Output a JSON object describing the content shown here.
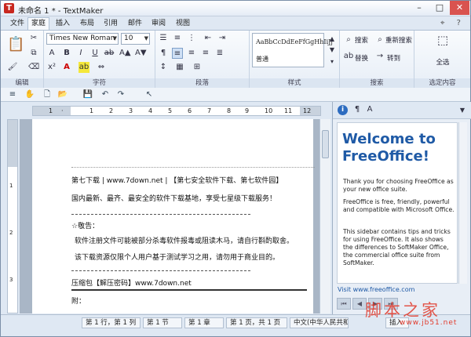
{
  "window": {
    "title": "未命名 1 * - TextMaker",
    "app_icon": "T",
    "min": "–",
    "max": "□",
    "close": "✕"
  },
  "tabs": [
    "文件",
    "家庭",
    "插入",
    "布局",
    "引用",
    "邮件",
    "审阅",
    "视图"
  ],
  "tabs_right": "⌖ ?",
  "ribbon": {
    "groups": {
      "edit": "编辑",
      "font": "字符",
      "paragraph": "段落",
      "styles": "样式",
      "search": "搜索",
      "selection": "选定内容"
    },
    "font_name": "Times New Roman",
    "font_size": "10",
    "style_preview": "AaBbCcDdEeFfGgHhIiJj",
    "style_name": "普通",
    "search_label": "搜索",
    "replace_search_label": "重新搜索",
    "replace_label": "替换",
    "goto_label": "转到",
    "select_all_label": "全选"
  },
  "ruler": {
    "h_numbers": [
      "1",
      "·",
      "1",
      "2",
      "3",
      "4",
      "5",
      "6",
      "7",
      "8",
      "9",
      "10",
      "11",
      "12"
    ],
    "v_numbers": [
      "1",
      "2",
      "3"
    ]
  },
  "document": {
    "lines": [
      "第七下载 | www.7down.net | 【第七安全软件下载、第七软件园】",
      "国内最新、最齐、最安全的软件下载基地，享受七星级下载服务！",
      "☆敬告：",
      "软件注册文件可能被部分杀毒软件报毒或阻读木马，请自行斟酌取舍。",
      "该下载资源仅限个人用户基于测试学习之用，请勿用于商业目的。",
      "压缩包【解压密码】www.7down.net",
      "附："
    ]
  },
  "sidebar": {
    "title_line1": "Welcome to",
    "title_line2": "FreeOffice!",
    "p1": "Thank you for choosing FreeOffice as your new office suite.",
    "p2": "FreeOffice is free, friendly, powerful and compatible with Microsoft Office.",
    "p3": "This sidebar contains tips and tricks for using FreeOffice. It also shows the differences to SoftMaker Office, the commercial office suite from SoftMaker.",
    "link": "Visit www.freeoffice.com"
  },
  "status": {
    "line_col": "第 1 行，第 1 列",
    "section": "第 1 节",
    "chapter": "第 1 章",
    "page": "第 1 页，共 1 页",
    "language": "中文(中华人民共和",
    "mode": "插入"
  },
  "watermark": {
    "text": "脚本之家",
    "url": "www.jb51.net"
  }
}
